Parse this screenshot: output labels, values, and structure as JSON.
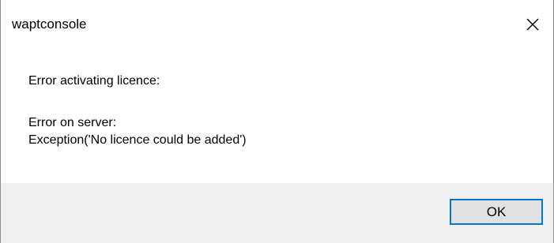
{
  "window": {
    "title": "waptconsole",
    "close_icon": "close-icon"
  },
  "message": {
    "line1": "Error activating licence:",
    "line2": "Error on server:",
    "line3": "Exception('No licence could be added')"
  },
  "buttons": {
    "ok_label": "OK"
  },
  "colors": {
    "footer_background": "#f0f0f0",
    "button_border_focus": "#0078d7",
    "button_background": "#e1e1e1",
    "window_border": "#8c8c8c"
  }
}
